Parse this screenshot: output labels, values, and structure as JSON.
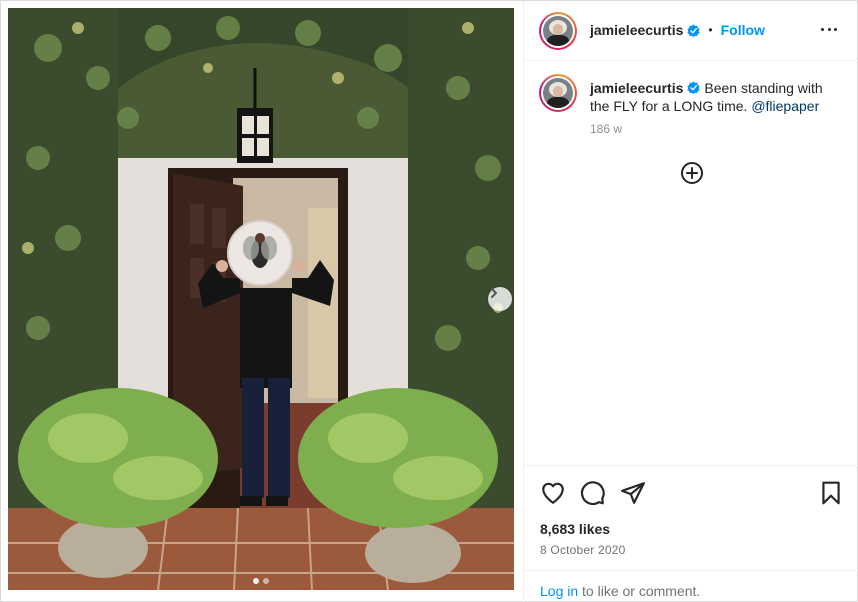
{
  "post": {
    "author": "jamieleecurtis",
    "follow_label": "Follow",
    "separator": "•",
    "caption": {
      "username": "jamieleecurtis",
      "text": "Been standing with the FLY for a LONG time.",
      "mention": "@fliepaper",
      "relative_time": "186 w"
    },
    "likes": "8,683 likes",
    "date": "8 October 2020",
    "login": {
      "link": "Log in",
      "rest": " to like or comment."
    },
    "carousel": {
      "slide_count": 2,
      "active_index": 0
    }
  },
  "icons": {
    "verified": "verified-badge-icon",
    "more": "more-options-icon",
    "load_more": "load-more-comments-icon",
    "like": "heart-icon",
    "comment": "comment-icon",
    "share": "share-icon",
    "save": "bookmark-icon",
    "next": "chevron-right-icon"
  },
  "colors": {
    "accent": "#0095f6",
    "text": "#262626",
    "muted": "#737373",
    "mention": "#00376b",
    "border": "#dbdbdb"
  }
}
